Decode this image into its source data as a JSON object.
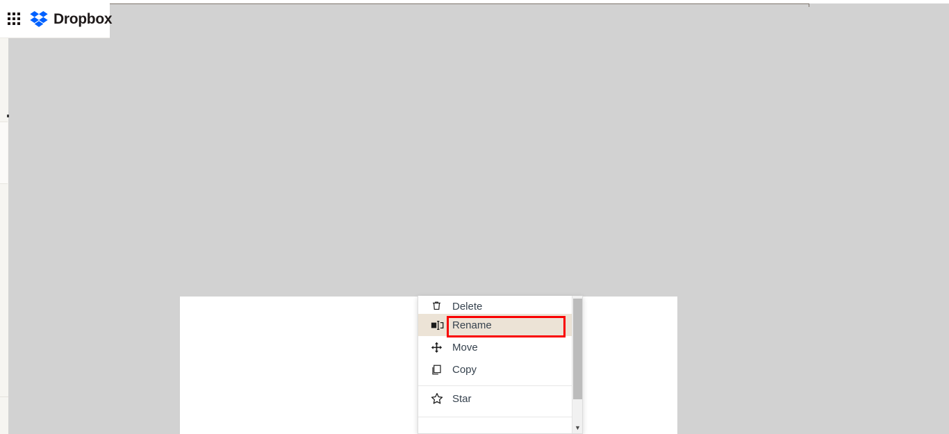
{
  "app": {
    "brand_name": "Dropbox",
    "brand_color": "#0061ff",
    "apps_launcher_icon": "grid-apps-icon"
  },
  "context_menu": {
    "items": [
      {
        "label": "Delete",
        "icon": "trash-icon",
        "highlighted": false
      },
      {
        "label": "Rename",
        "icon": "rename-icon",
        "highlighted": true
      },
      {
        "label": "Move",
        "icon": "move-arrows-icon",
        "highlighted": false
      },
      {
        "label": "Copy",
        "icon": "copy-icon",
        "highlighted": false
      },
      {
        "label": "Star",
        "icon": "star-icon",
        "highlighted": false
      }
    ],
    "highlight_color": "#ece3d6",
    "scrollbar": {
      "down_arrow_glyph": "▼"
    }
  },
  "annotation": {
    "target_label": "Rename",
    "color": "#f90000"
  }
}
